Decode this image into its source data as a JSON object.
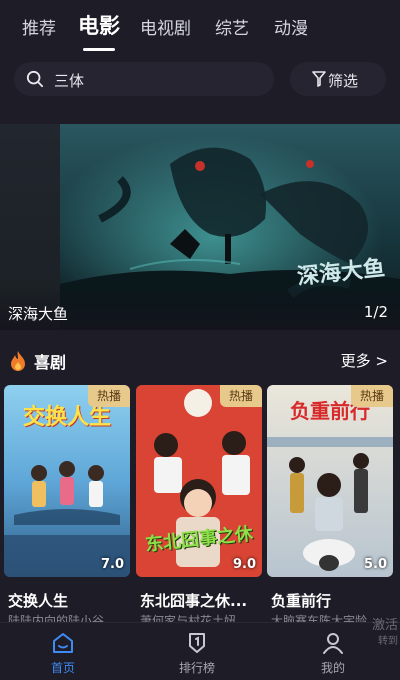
{
  "tabs": [
    {
      "label": "推荐"
    },
    {
      "label": "电影"
    },
    {
      "label": "电视剧"
    },
    {
      "label": "综艺"
    },
    {
      "label": "动漫"
    }
  ],
  "search": {
    "text": "三体",
    "icon": "search-icon"
  },
  "filter": {
    "label": "筛选",
    "icon": "filter-icon"
  },
  "banner": {
    "caption": "深海大鱼",
    "page": "1/2",
    "overlay_text": "深海大鱼"
  },
  "section": {
    "title": "喜剧",
    "more": "更多 >",
    "icon": "fire-icon"
  },
  "cards": [
    {
      "badge": "热播",
      "rating": "7.0",
      "poster_text": "交换人生",
      "title": "交换人生",
      "subtitle": "陆陆内向的陆小谷"
    },
    {
      "badge": "热播",
      "rating": "9.0",
      "poster_text": "东北囧事之休",
      "title": "东北囧事之休...",
      "subtitle": "萧何家与村花土妞"
    },
    {
      "badge": "热播",
      "rating": "5.0",
      "poster_text": "负重前行",
      "title": "负重前行",
      "subtitle": "大脑赛车陈大宇龄"
    }
  ],
  "nav": [
    {
      "label": "首页",
      "icon": "home-icon"
    },
    {
      "label": "排行榜",
      "icon": "ranking-icon"
    },
    {
      "label": "我的",
      "icon": "profile-icon"
    }
  ],
  "watermark": {
    "line1": "激活",
    "line2": "转到"
  },
  "colors": {
    "accent": "#3e8bf6",
    "background": "#1e1c26",
    "badge": "#e7c98c"
  }
}
